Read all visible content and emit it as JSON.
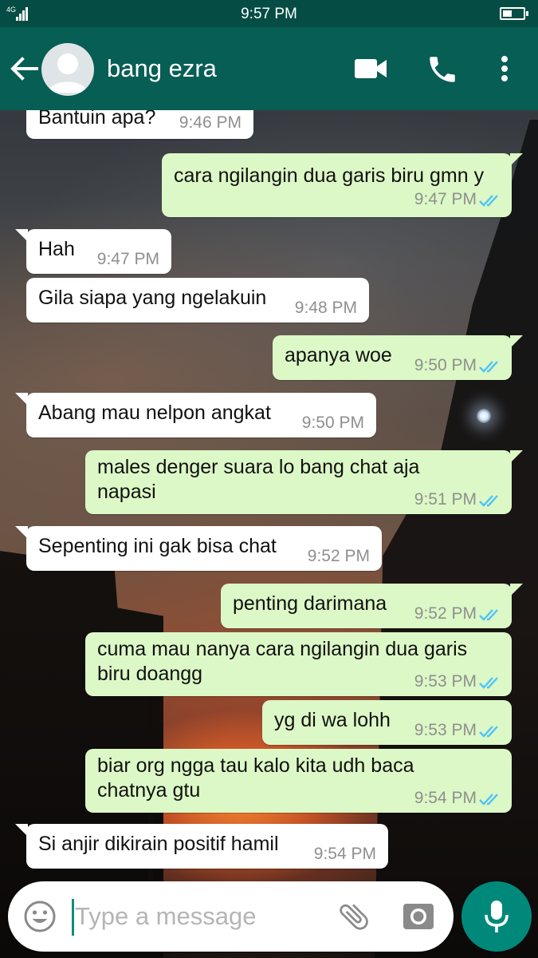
{
  "status_bar": {
    "network": "4G",
    "time": "9:57 PM"
  },
  "header": {
    "contact_name": "bang ezra",
    "icons": [
      "back-arrow-icon",
      "avatar-placeholder-icon",
      "video-call-icon",
      "phone-icon",
      "more-vert-icon"
    ]
  },
  "messages": [
    {
      "direction": "in",
      "text": "Bantuin apa?",
      "time": "9:46 PM"
    },
    {
      "direction": "out",
      "text": "cara ngilangin dua garis biru gmn y",
      "time": "9:47 PM",
      "status": "read"
    },
    {
      "direction": "in",
      "text": "Hah",
      "time": "9:47 PM"
    },
    {
      "direction": "in",
      "text": "Gila siapa yang ngelakuin",
      "time": "9:48 PM"
    },
    {
      "direction": "out",
      "text": "apanya woe",
      "time": "9:50 PM",
      "status": "read"
    },
    {
      "direction": "in",
      "text": "Abang mau nelpon angkat",
      "time": "9:50 PM"
    },
    {
      "direction": "out",
      "text_lines": [
        "males denger suara lo bang chat aja",
        "napasi"
      ],
      "time": "9:51 PM",
      "status": "read"
    },
    {
      "direction": "in",
      "text": "Sepenting ini gak bisa chat",
      "time": "9:52 PM"
    },
    {
      "direction": "out",
      "text": "penting darimana",
      "time": "9:52 PM",
      "status": "read"
    },
    {
      "direction": "out",
      "text_lines": [
        "cuma mau nanya cara ngilangin dua garis",
        "biru doangg"
      ],
      "time": "9:53 PM",
      "status": "read"
    },
    {
      "direction": "out",
      "text": "yg di wa lohh",
      "time": "9:53 PM",
      "status": "read"
    },
    {
      "direction": "out",
      "text_lines": [
        "biar org ngga tau kalo kita udh baca",
        "chatnya gtu"
      ],
      "time": "9:54 PM",
      "status": "read"
    },
    {
      "direction": "in",
      "text": "Si anjir dikirain positif hamil",
      "time": "9:54 PM"
    }
  ],
  "composer": {
    "placeholder": "Type a message",
    "value": "",
    "icons": [
      "emoji-icon",
      "attach-icon",
      "camera-icon",
      "mic-icon"
    ]
  },
  "colors": {
    "header": "#075e54",
    "status_bar": "#054d44",
    "outgoing_bubble": "#dcf8c6",
    "incoming_bubble": "#ffffff",
    "read_ticks": "#4fc3f7",
    "mic_button": "#00897b"
  }
}
